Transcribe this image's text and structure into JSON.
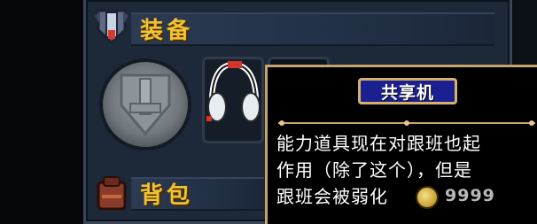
{
  "equipment": {
    "title": "装备",
    "icon": "armor-shield-icon"
  },
  "backpack": {
    "title": "背包",
    "icon": "backpack-icon"
  },
  "slots": {
    "empty_slot_icon": "shield-silhouette-icon",
    "equipped_item_icon": "headphones-icon"
  },
  "tooltip": {
    "item_name": "共享机",
    "description_lines": [
      "能力道具现在对跟班也起",
      "作用（除了这个），但是",
      "跟班会被弱化"
    ],
    "price": "9999",
    "price_icon": "gold-coin-icon"
  },
  "colors": {
    "title_gold": "#f2c230",
    "tooltip_name_bg": "#1a2090",
    "tooltip_border": "#c9a46a",
    "panel_bg": "#1d2838"
  }
}
